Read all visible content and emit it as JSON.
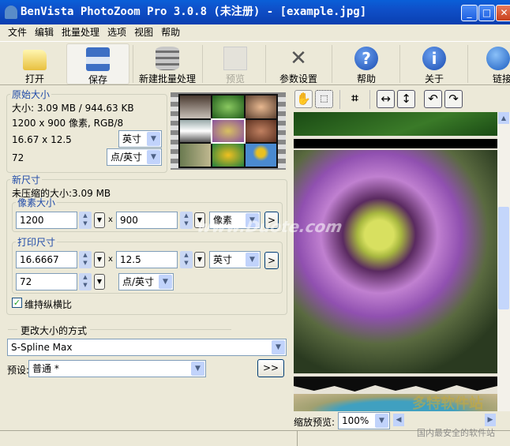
{
  "window": {
    "title": "BenVista PhotoZoom Pro 3.0.8 (未注册) - [example.jpg]",
    "minimize": "_",
    "maximize": "□",
    "close": "✕"
  },
  "menu": [
    "文件",
    "编辑",
    "批量处理",
    "选项",
    "视图",
    "帮助"
  ],
  "toolbar": [
    {
      "label": "打开",
      "icon": "folder-open-icon"
    },
    {
      "label": "保存",
      "icon": "floppy-save-icon",
      "active": true
    },
    {
      "label": "新建批量处理",
      "icon": "database-batch-icon"
    },
    {
      "label": "预览",
      "icon": "preview-image-icon",
      "disabled": true
    },
    {
      "label": "参数设置",
      "icon": "tools-settings-icon"
    },
    {
      "label": "帮助",
      "icon": "help-question-icon"
    },
    {
      "label": "关于",
      "icon": "info-icon"
    },
    {
      "label": "链接",
      "icon": "globe-link-icon"
    }
  ],
  "original": {
    "legend": "原始大小",
    "size": "大小: 3.09 MB / 944.63 KB",
    "dims": "1200 x 900 像素, RGB/8",
    "print": "16.67 x 12.5",
    "print_unit": "英寸",
    "res": "72",
    "res_unit": "点/英寸"
  },
  "newsize": {
    "legend": "新尺寸",
    "uncompressed": "未压缩的大小:3.09 MB",
    "pixel": {
      "legend": "像素大小",
      "width": "1200",
      "x": "x",
      "height": "900",
      "unit": "像素",
      "more": ">"
    },
    "print": {
      "legend": "打印尺寸",
      "width": "16.6667",
      "x": "x",
      "height": "12.5",
      "unit": "英寸",
      "more": ">",
      "res": "72",
      "res_unit": "点/英寸"
    },
    "keep_ratio": {
      "label": "维持纵横比",
      "checked": true
    }
  },
  "method": {
    "legend": "更改大小的方式",
    "value": "S-Spline Max"
  },
  "preset": {
    "label": "预设:",
    "value": "普通 *",
    "more": ">>"
  },
  "preview_tools": [
    "hand-icon",
    "select-icon",
    "crop-icon",
    "fit-width-icon",
    "fit-height-icon",
    "rotate-left-icon",
    "rotate-right-icon"
  ],
  "zoom": {
    "label": "缩放预览:",
    "value": "100%"
  },
  "watermark": {
    "text1": "www.Duote.com",
    "text2": "多特软件站",
    "text3": "国内最安全的软件站"
  }
}
